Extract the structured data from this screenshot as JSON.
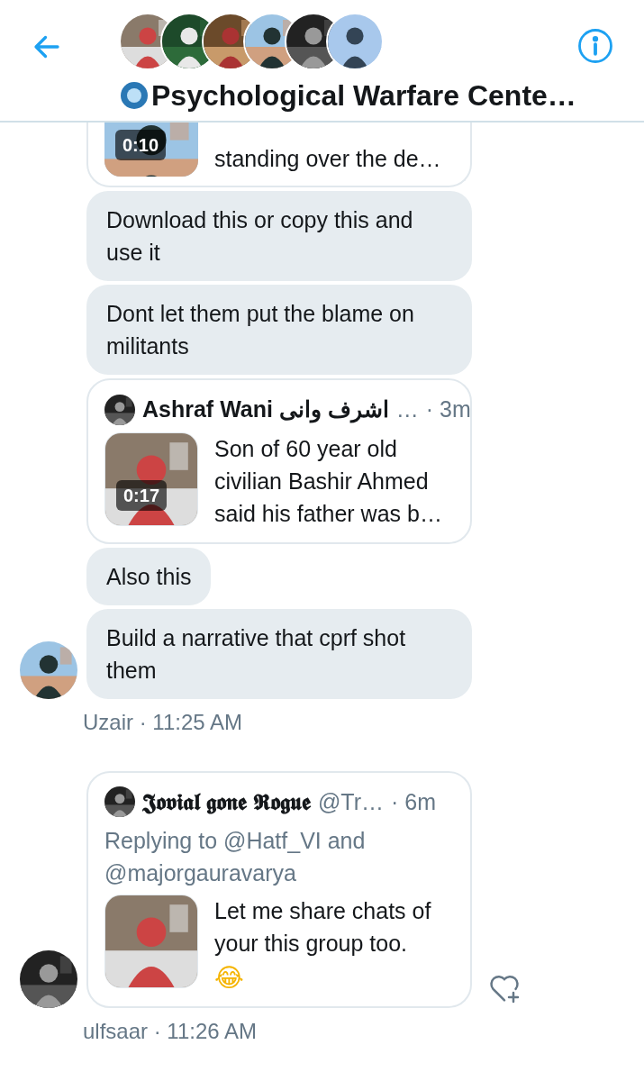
{
  "header": {
    "title": "Psychological Warfare Cente…"
  },
  "groups": [
    {
      "meta": "Uzair · 11:25 AM",
      "items": [
        {
          "kind": "tweet",
          "clipped": true,
          "duration": "0:10",
          "text": "standing over the de…"
        },
        {
          "kind": "text",
          "text": "Download this or copy this and use it"
        },
        {
          "kind": "text",
          "text": "Dont let them put the blame on militants"
        },
        {
          "kind": "tweet",
          "author": "Ashraf Wani اشرف وانی",
          "handle": "…",
          "time": "· 3m",
          "duration": "0:17",
          "text": "Son of 60 year old civilian Bashir Ahmed said his father was b…"
        },
        {
          "kind": "text",
          "text": "Also this"
        },
        {
          "kind": "text",
          "text": "Build a narrative that cprf shot them"
        }
      ]
    },
    {
      "meta": "ulfsaar · 11:26 AM",
      "items": [
        {
          "kind": "tweet",
          "author": "𝕵𝖔𝖛𝖎𝖆𝖑 𝖌𝖔𝖓𝖊 𝕽𝖔𝖌𝖚𝖊",
          "handle": "@Tr…",
          "time": "· 6m",
          "reply": "Replying to @Hatf_VI and @majorgauravarya",
          "text": "Let me share chats of your this group too.",
          "emoji": "😂",
          "reaction": true
        }
      ]
    }
  ]
}
